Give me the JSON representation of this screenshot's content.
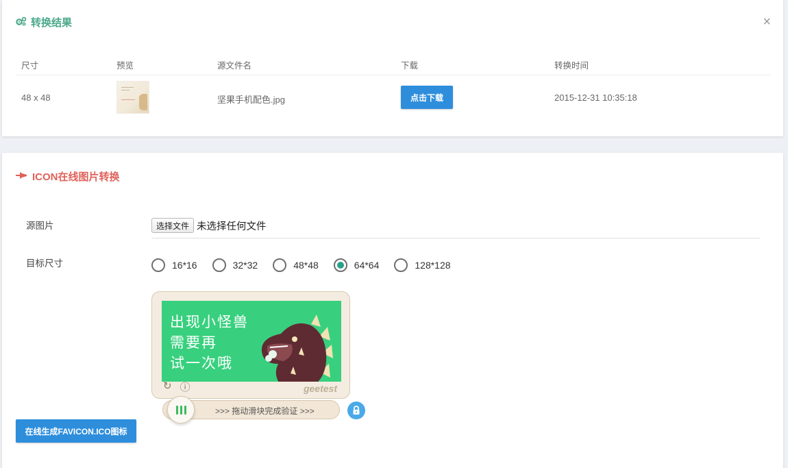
{
  "result_panel": {
    "title": "转换结果",
    "close_icon": "close-icon",
    "columns": [
      "尺寸",
      "预览",
      "源文件名",
      "下载",
      "转换时间"
    ],
    "rows": [
      {
        "size": "48 x 48",
        "source_file": "坚果手机配色.jpg",
        "download_label": "点击下载",
        "converted_at": "2015-12-31 10:35:18"
      }
    ]
  },
  "converter_panel": {
    "title": "ICON在线图片转换",
    "source_label": "源图片",
    "file_button": "选择文件",
    "file_status": "未选择任何文件",
    "target_label": "目标尺寸",
    "sizes": [
      "16*16",
      "32*32",
      "48*48",
      "64*64",
      "128*128"
    ],
    "selected_size": "64*64",
    "captcha": {
      "lines": [
        "出现小怪兽",
        "需要再",
        "试一次哦"
      ],
      "brand": "geetest",
      "slider_hint": ">>> 拖动滑块完成验证 >>>"
    },
    "generate_button": "在线生成FAVICON.ICO图标"
  },
  "colors": {
    "accent_blue": "#2e8edc",
    "result_title": "#4aa88a",
    "converter_title": "#e0615a",
    "captcha_green": "#38d07e"
  }
}
